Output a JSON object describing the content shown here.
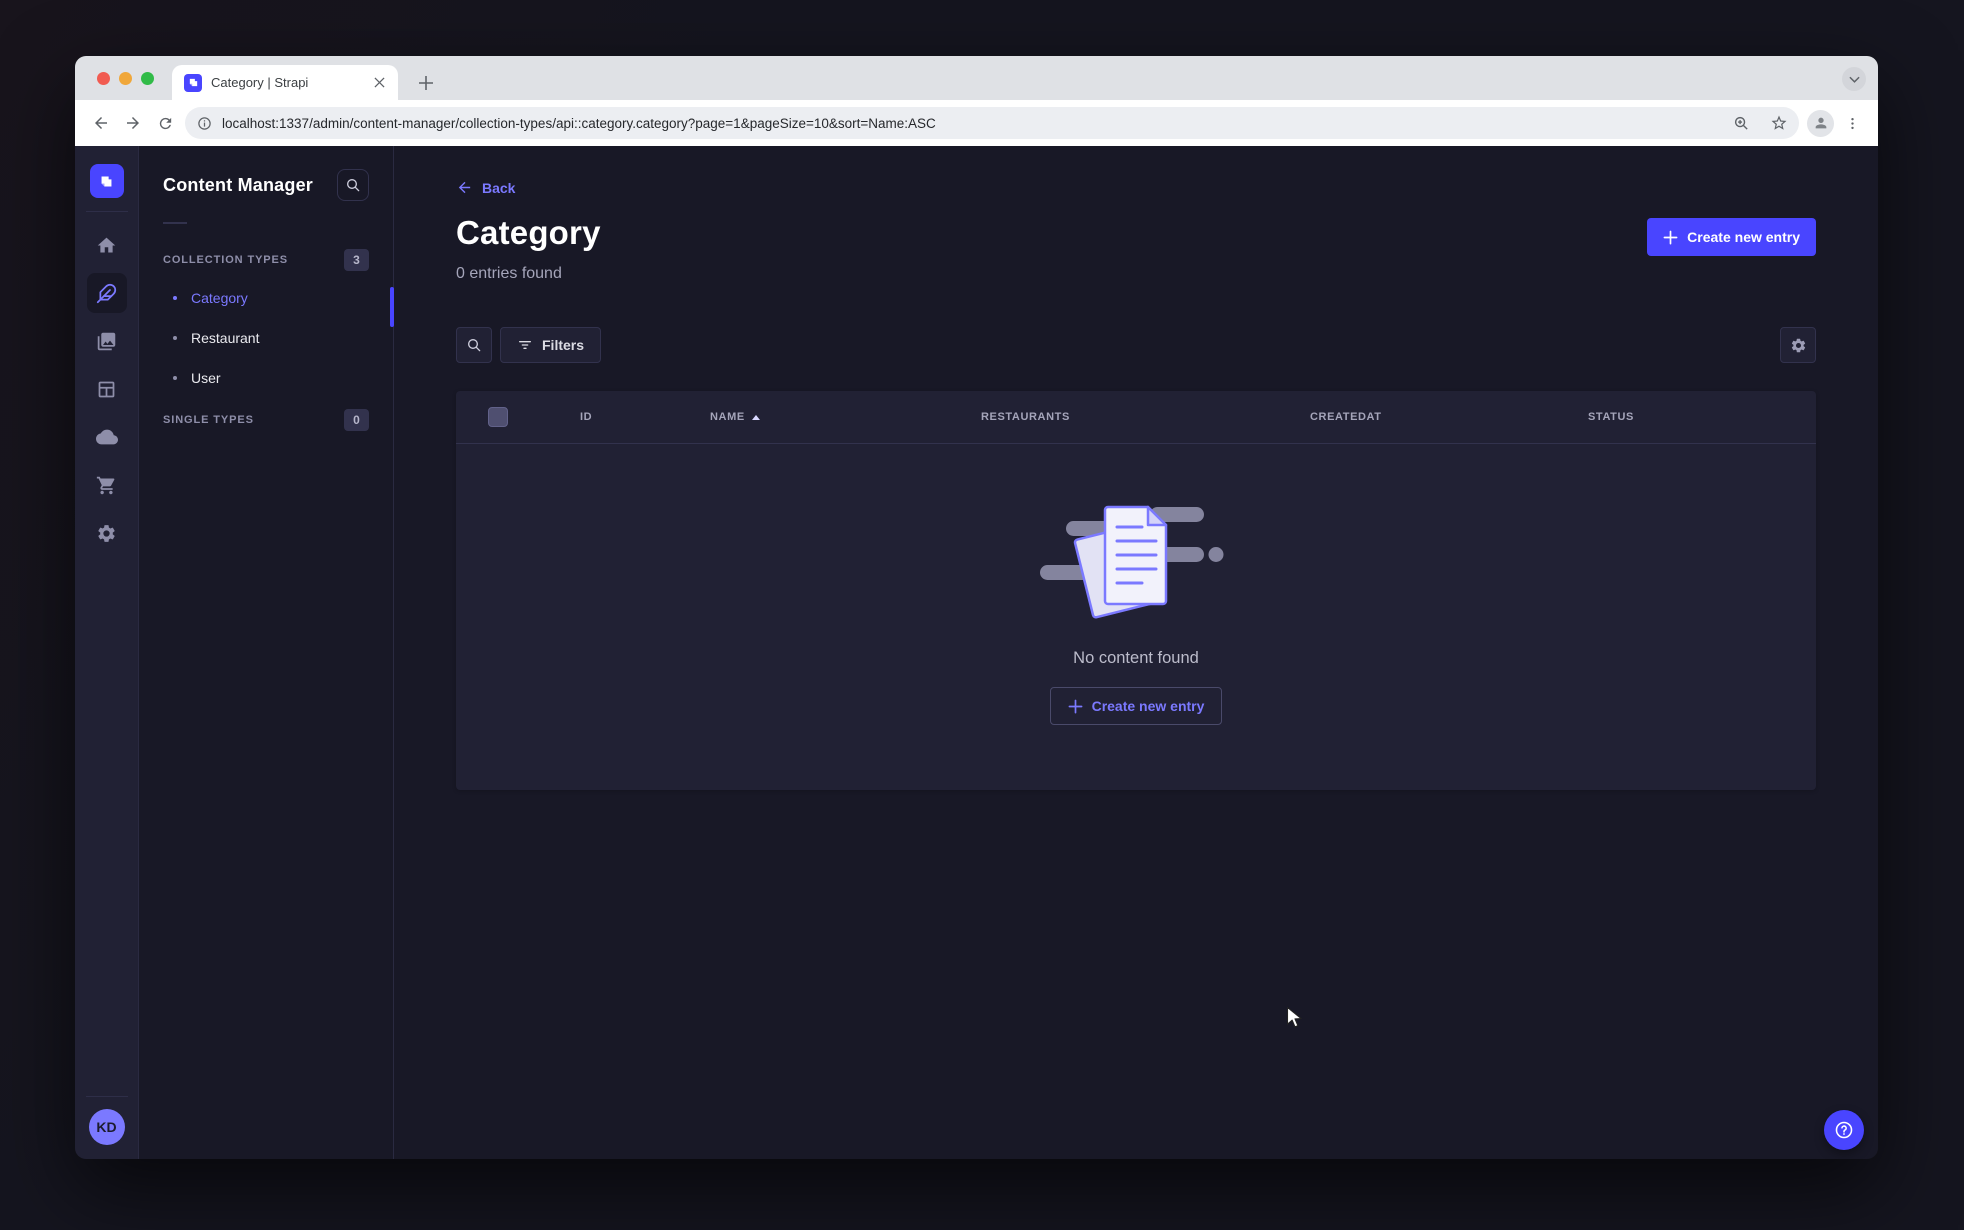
{
  "browser": {
    "tab_title": "Category | Strapi",
    "url": "localhost:1337/admin/content-manager/collection-types/api::category.category?page=1&pageSize=10&sort=Name:ASC"
  },
  "sidebar": {
    "icons": [
      "strapi-logo",
      "home",
      "content-manager",
      "media-library",
      "content-type-builder",
      "cloud",
      "marketplace",
      "settings"
    ]
  },
  "subnav": {
    "title": "Content Manager",
    "collection_types": {
      "label": "COLLECTION TYPES",
      "badge": "3",
      "items": [
        "Category",
        "Restaurant",
        "User"
      ]
    },
    "single_types": {
      "label": "SINGLE TYPES",
      "badge": "0"
    }
  },
  "main": {
    "back_label": "Back",
    "title": "Category",
    "subtitle": "0 entries found",
    "create_button": "Create new entry",
    "filters_button": "Filters",
    "table": {
      "headers": [
        "ID",
        "NAME",
        "RESTAURANTS",
        "CREATEDAT",
        "STATUS"
      ],
      "sorted_by": "NAME",
      "sort_direction": "ASC"
    },
    "empty": {
      "message": "No content found",
      "cta": "Create new entry"
    }
  },
  "user": {
    "initials": "KD"
  },
  "colors": {
    "primary": "#4945ff",
    "primary_text": "#7b79ff",
    "app_background": "#181826",
    "surface": "#212134",
    "border": "#32324d",
    "muted_text": "#a5a5ba"
  }
}
